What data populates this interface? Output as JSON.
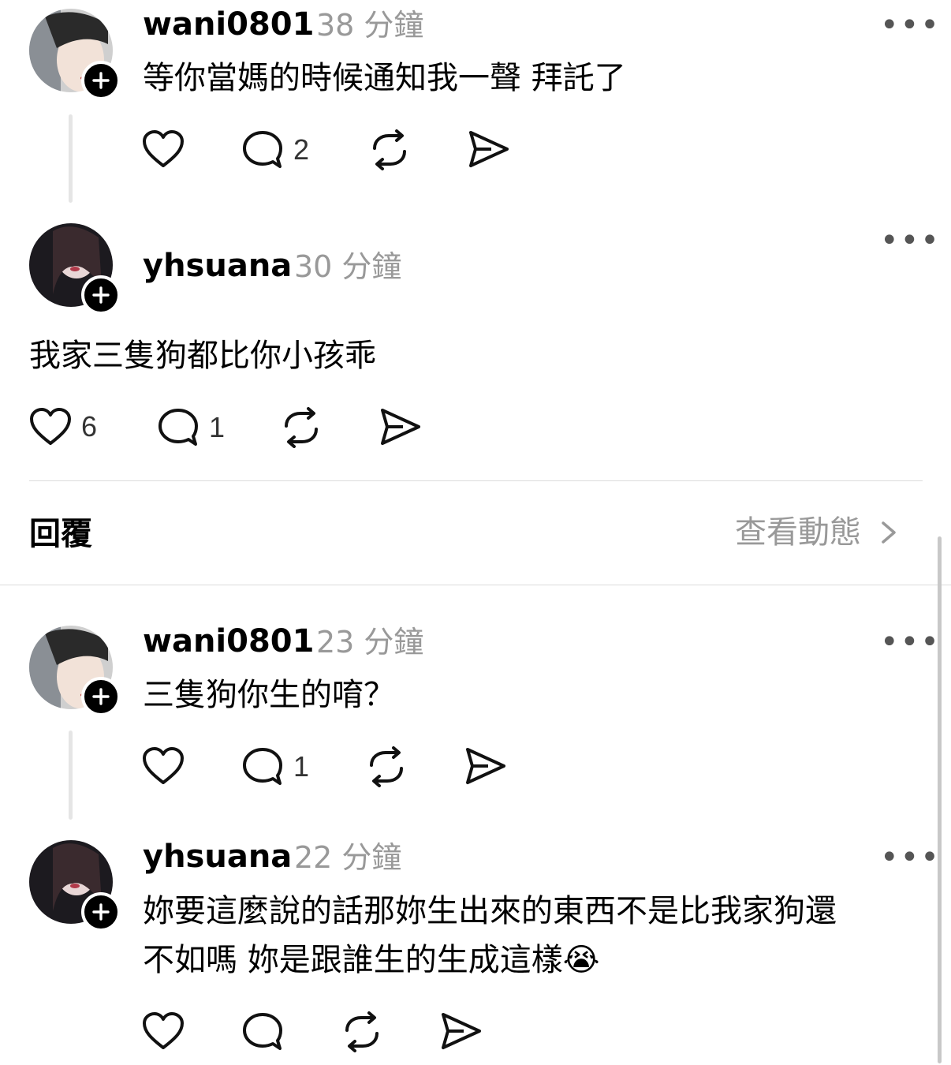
{
  "comments": [
    {
      "username": "wani0801",
      "time": "38 分鐘",
      "text_lines": [
        "等你當媽的時候通知我一聲 拜託了"
      ],
      "likes": "",
      "replies": "2"
    },
    {
      "username": "yhsuana",
      "time": "30 分鐘",
      "text_lines": [
        "我家三隻狗都比你小孩乖"
      ],
      "likes": "6",
      "replies": "1"
    },
    {
      "username": "wani0801",
      "time": "23 分鐘",
      "text_lines": [
        "三隻狗你生的唷？"
      ],
      "likes": "",
      "replies": "1"
    },
    {
      "username": "yhsuana",
      "time": "22 分鐘",
      "text_lines": [
        "妳要這麼說的話那妳生出來的東西不是比我家狗還",
        "不如嗎 妳是跟誰生的生成這樣😭"
      ],
      "likes": "",
      "replies": ""
    }
  ],
  "section": {
    "title": "回覆",
    "view_activity": "查看動態"
  },
  "more_label": "•••",
  "icons": {
    "like": "heart-icon",
    "comment": "comment-bubble-icon",
    "repost": "repost-icon",
    "share": "send-icon",
    "follow": "plus-icon",
    "chevron": "chevron-right-icon"
  }
}
